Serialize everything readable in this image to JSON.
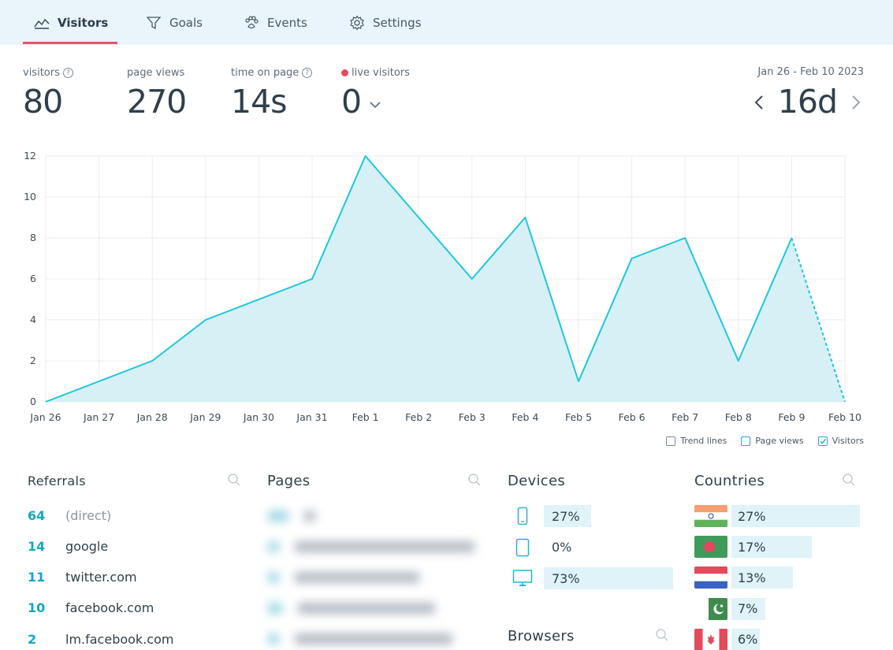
{
  "tabs": [
    {
      "label": "Visitors",
      "icon": "chart-icon",
      "active": true
    },
    {
      "label": "Goals",
      "icon": "filter-icon",
      "active": false
    },
    {
      "label": "Events",
      "icon": "paw-icon",
      "active": false
    },
    {
      "label": "Settings",
      "icon": "gear-icon",
      "active": false
    }
  ],
  "stats": {
    "visitors": {
      "label": "visitors",
      "value": "80"
    },
    "page_views": {
      "label": "page views",
      "value": "270"
    },
    "time_on_page": {
      "label": "time on page",
      "value": "14s"
    },
    "live_visitors": {
      "label": "live visitors",
      "value": "0"
    }
  },
  "date_range": {
    "label": "Jan 26 - Feb 10 2023",
    "period": "16d"
  },
  "chart_data": {
    "type": "area",
    "x": [
      "Jan 26",
      "Jan 27",
      "Jan 28",
      "Jan 29",
      "Jan 30",
      "Jan 31",
      "Feb 1",
      "Feb 2",
      "Feb 3",
      "Feb 4",
      "Feb 5",
      "Feb 6",
      "Feb 7",
      "Feb 8",
      "Feb 9",
      "Feb 10"
    ],
    "series": [
      {
        "name": "Visitors",
        "values": [
          0,
          1,
          2,
          4,
          5,
          6,
          12,
          9,
          6,
          9,
          1,
          7,
          8,
          2,
          8,
          0
        ],
        "color": "#1ec6e0",
        "last_segment_dashed": true
      }
    ],
    "yticks": [
      0,
      2,
      4,
      6,
      8,
      10,
      12
    ],
    "ylim": [
      0,
      12
    ],
    "grid": true,
    "fill_color": "#d6f0f5"
  },
  "legend": {
    "trend_lines": {
      "label": "Trend lines",
      "checked": false
    },
    "page_views": {
      "label": "Page views",
      "checked": false
    },
    "visitors": {
      "label": "Visitors",
      "checked": true
    }
  },
  "referrals": {
    "title": "Referrals",
    "items": [
      {
        "count": "64",
        "name": "(direct)"
      },
      {
        "count": "14",
        "name": "google"
      },
      {
        "count": "11",
        "name": "twitter.com"
      },
      {
        "count": "10",
        "name": "facebook.com"
      },
      {
        "count": "2",
        "name": "lm.facebook.com"
      }
    ]
  },
  "pages": {
    "title": "Pages"
  },
  "devices": {
    "title": "Devices",
    "items": [
      {
        "icon": "mobile-icon",
        "percent": "27%",
        "fraction": 0.27
      },
      {
        "icon": "tablet-icon",
        "percent": "0%",
        "fraction": 0.0
      },
      {
        "icon": "desktop-icon",
        "percent": "73%",
        "fraction": 0.73
      }
    ]
  },
  "browsers": {
    "title": "Browsers"
  },
  "countries": {
    "title": "Countries",
    "items": [
      {
        "flag": "india-flag-icon",
        "percent": "27%",
        "fraction": 0.27
      },
      {
        "flag": "bangladesh-flag-icon",
        "percent": "17%",
        "fraction": 0.17
      },
      {
        "flag": "netherlands-flag-icon",
        "percent": "13%",
        "fraction": 0.13
      },
      {
        "flag": "pakistan-flag-icon",
        "percent": "7%",
        "fraction": 0.07
      },
      {
        "flag": "canada-flag-icon",
        "percent": "6%",
        "fraction": 0.06
      }
    ]
  },
  "colors": {
    "accent": "#e0566b",
    "count": "#12a8c6",
    "line": "#1ec6e0",
    "bar": "#dff3f9",
    "live": "#f0465a"
  }
}
